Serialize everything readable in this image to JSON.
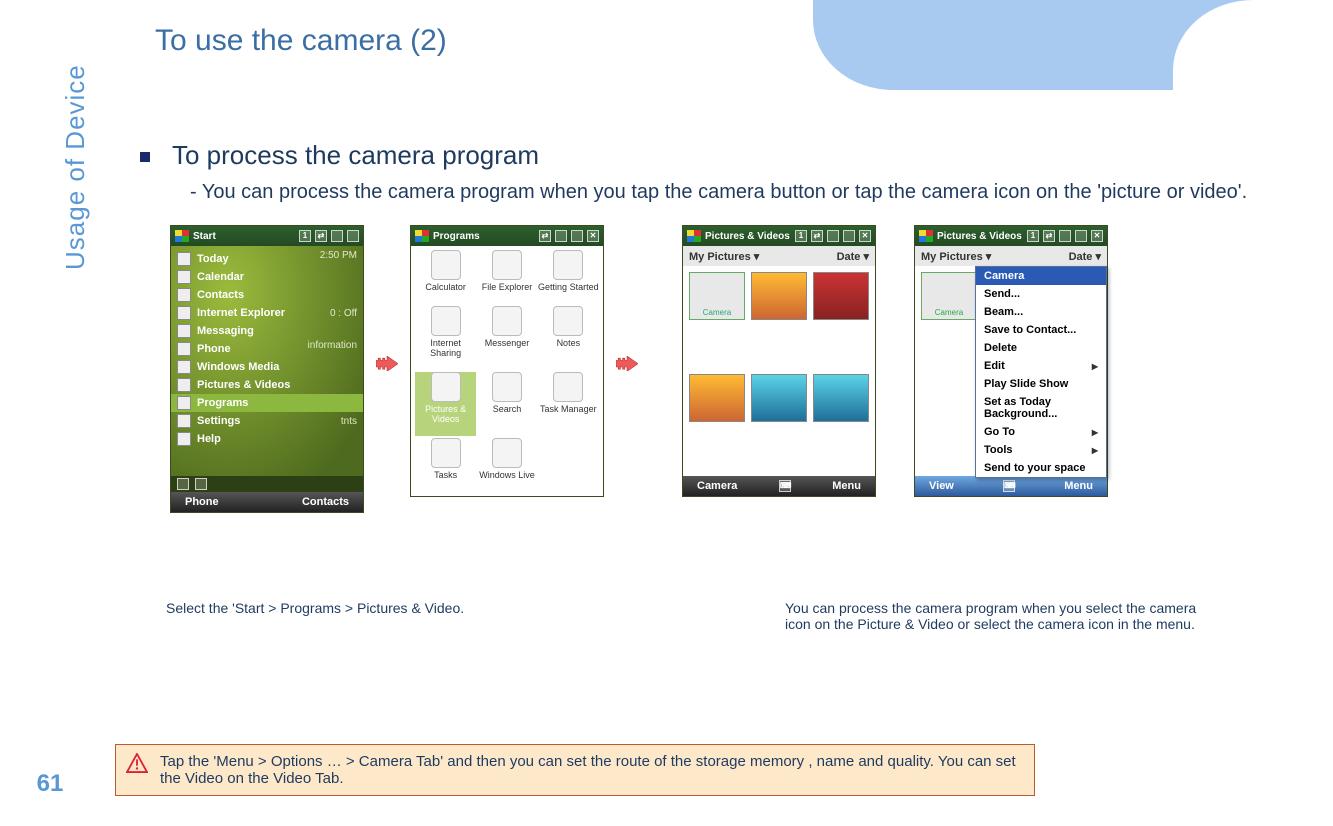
{
  "page_title": "To use the camera (2)",
  "side_label": "Usage of Device",
  "page_number": "61",
  "bullet": "To process the camera program",
  "sub": "- You can process the camera program when you tap the camera button or tap the camera icon on the 'picture or video'.",
  "caption1": "Select the 'Start > Programs > Pictures & Video.",
  "caption2": "You can process the camera program when you select the camera icon on the Picture & Video or select the camera icon in the menu.",
  "tip": "Tap the 'Menu > Options … > Camera Tab' and then you can set the route of the storage memory , name and quality. You can set the Video on the Video Tab.",
  "shot1": {
    "title": "Start",
    "time": "2:50 PM",
    "battery": "0 : Off",
    "info": "information",
    "ints": "tnts",
    "items": [
      "Today",
      "Calendar",
      "Contacts",
      "Internet Explorer",
      "Messaging",
      "Phone",
      "Windows Media",
      "Pictures & Videos",
      "Programs",
      "Settings",
      "Help"
    ],
    "selected_index": 8,
    "softkeys": [
      "Phone",
      "Contacts"
    ]
  },
  "shot2": {
    "title": "Programs",
    "items": [
      "Calculator",
      "File Explorer",
      "Getting Started",
      "Internet Sharing",
      "Messenger",
      "Notes",
      "Pictures & Videos",
      "Search",
      "Task Manager",
      "Tasks",
      "Windows Live"
    ],
    "selected_index": 6
  },
  "shot3": {
    "title": "Pictures & Videos",
    "folder": "My Pictures",
    "sort": "Date",
    "camera_label": "Camera",
    "softkeys": [
      "Camera",
      "Menu"
    ]
  },
  "shot4": {
    "title": "Pictures & Videos",
    "folder": "My Pictures",
    "sort": "Date",
    "camera_label": "Camera",
    "ctx": [
      "Camera",
      "Send...",
      "Beam...",
      "Save to Contact...",
      "Delete",
      "Edit",
      "Play Slide Show",
      "Set as Today Background...",
      "Go To",
      "Tools",
      "Send to your space"
    ],
    "ctx_highlight": 0,
    "softkeys": [
      "View",
      "Menu"
    ]
  }
}
